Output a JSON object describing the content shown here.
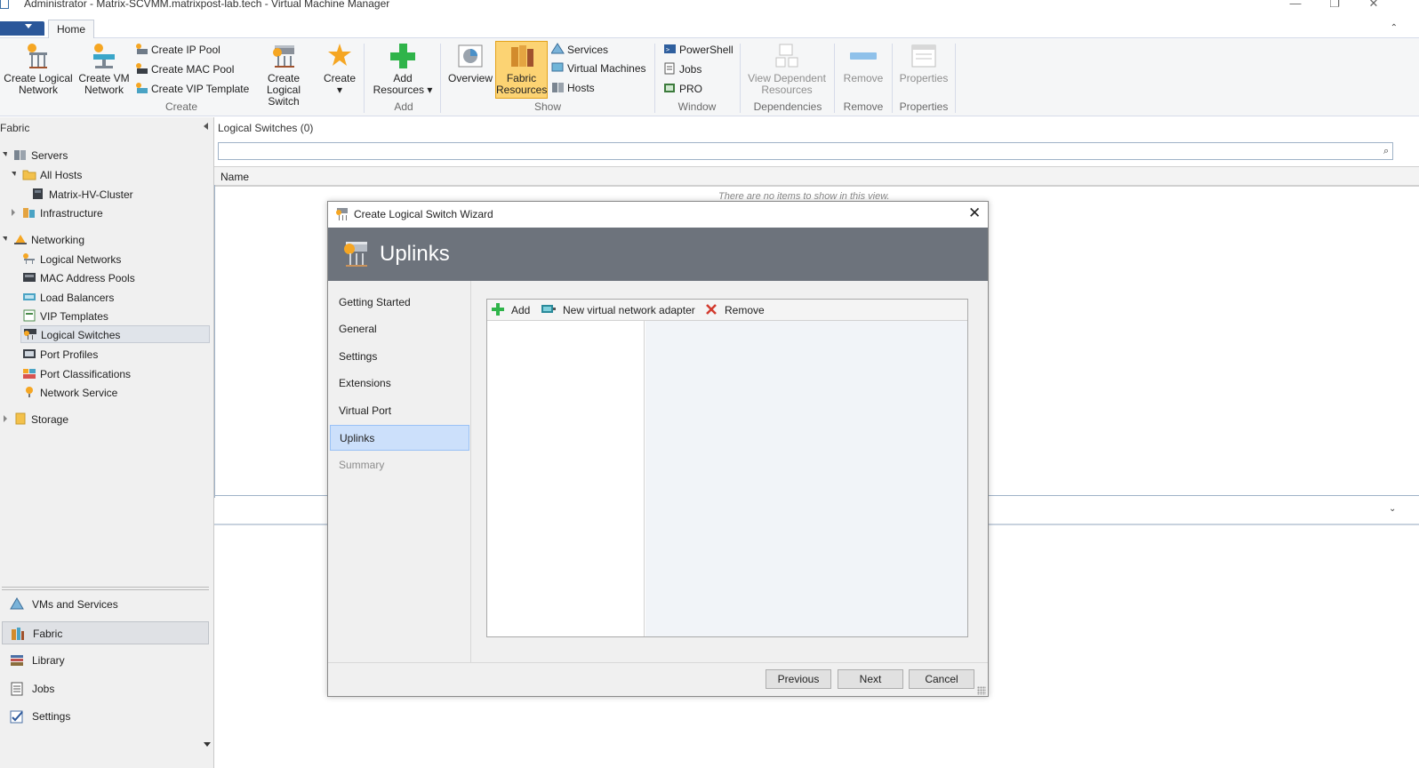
{
  "window": {
    "title": "Administrator - Matrix-SCVMM.matrixpost-lab.tech - Virtual Machine Manager",
    "minimize_glyph": "—",
    "restore_glyph": "❐",
    "close_glyph": "✕"
  },
  "ribbon": {
    "home_tab": "Home",
    "collapse_glyph": "⌃",
    "create": {
      "group_label": "Create",
      "create_logical_network_1": "Create Logical",
      "create_logical_network_2": "Network",
      "create_vm_network_1": "Create VM",
      "create_vm_network_2": "Network",
      "create_ip_pool": "Create IP Pool",
      "create_mac_pool": "Create MAC Pool",
      "create_vip_template": "Create VIP Template",
      "create_logical_switch_1": "Create",
      "create_logical_switch_2": "Logical Switch",
      "create_dropdown": "Create",
      "create_dropdown_caret": "▾"
    },
    "add": {
      "group_label": "Add",
      "add_resources_1": "Add",
      "add_resources_2": "Resources ▾"
    },
    "show": {
      "group_label": "Show",
      "overview": "Overview",
      "fabric_resources_1": "Fabric",
      "fabric_resources_2": "Resources",
      "services": "Services",
      "virtual_machines": "Virtual Machines",
      "hosts": "Hosts"
    },
    "window_group": {
      "group_label": "Window",
      "powershell": "PowerShell",
      "jobs": "Jobs",
      "pro": "PRO"
    },
    "dependencies": {
      "group_label": "Dependencies",
      "view_dependent_1": "View Dependent",
      "view_dependent_2": "Resources"
    },
    "remove": {
      "group_label": "Remove",
      "remove": "Remove"
    },
    "properties": {
      "group_label": "Properties",
      "properties": "Properties"
    }
  },
  "nav": {
    "header": "Fabric",
    "tree": {
      "servers": "Servers",
      "all_hosts": "All Hosts",
      "cluster": "Matrix-HV-Cluster",
      "infrastructure": "Infrastructure",
      "networking": "Networking",
      "logical_networks": "Logical Networks",
      "mac_pools": "MAC Address Pools",
      "load_balancers": "Load Balancers",
      "vip_templates": "VIP Templates",
      "logical_switches": "Logical Switches",
      "port_profiles": "Port Profiles",
      "port_classifications": "Port Classifications",
      "network_service": "Network Service",
      "storage": "Storage"
    },
    "workspaces": {
      "vms_services": "VMs and Services",
      "fabric": "Fabric",
      "library": "Library",
      "jobs": "Jobs",
      "settings": "Settings"
    }
  },
  "main": {
    "header": "Logical Switches (0)",
    "search_glyph": "⌕",
    "column_name": "Name",
    "empty_message": "There are no items to show in this view.",
    "detail_chevron": "⌄"
  },
  "wizard": {
    "title": "Create Logical Switch Wizard",
    "close_glyph": "✕",
    "banner_title": "Uplinks",
    "steps": {
      "getting_started": "Getting Started",
      "general": "General",
      "settings": "Settings",
      "extensions": "Extensions",
      "virtual_port": "Virtual Port",
      "uplinks": "Uplinks",
      "summary": "Summary"
    },
    "toolbar": {
      "add": "Add",
      "new_vna": "New virtual network adapter",
      "remove": "Remove"
    },
    "buttons": {
      "previous": "Previous",
      "next": "Next",
      "cancel": "Cancel"
    }
  },
  "colors": {
    "accent": "#2b579a",
    "banner": "#6d737c",
    "selected_step": "#cce0fb",
    "selected_ribbon": "#fcd373"
  }
}
